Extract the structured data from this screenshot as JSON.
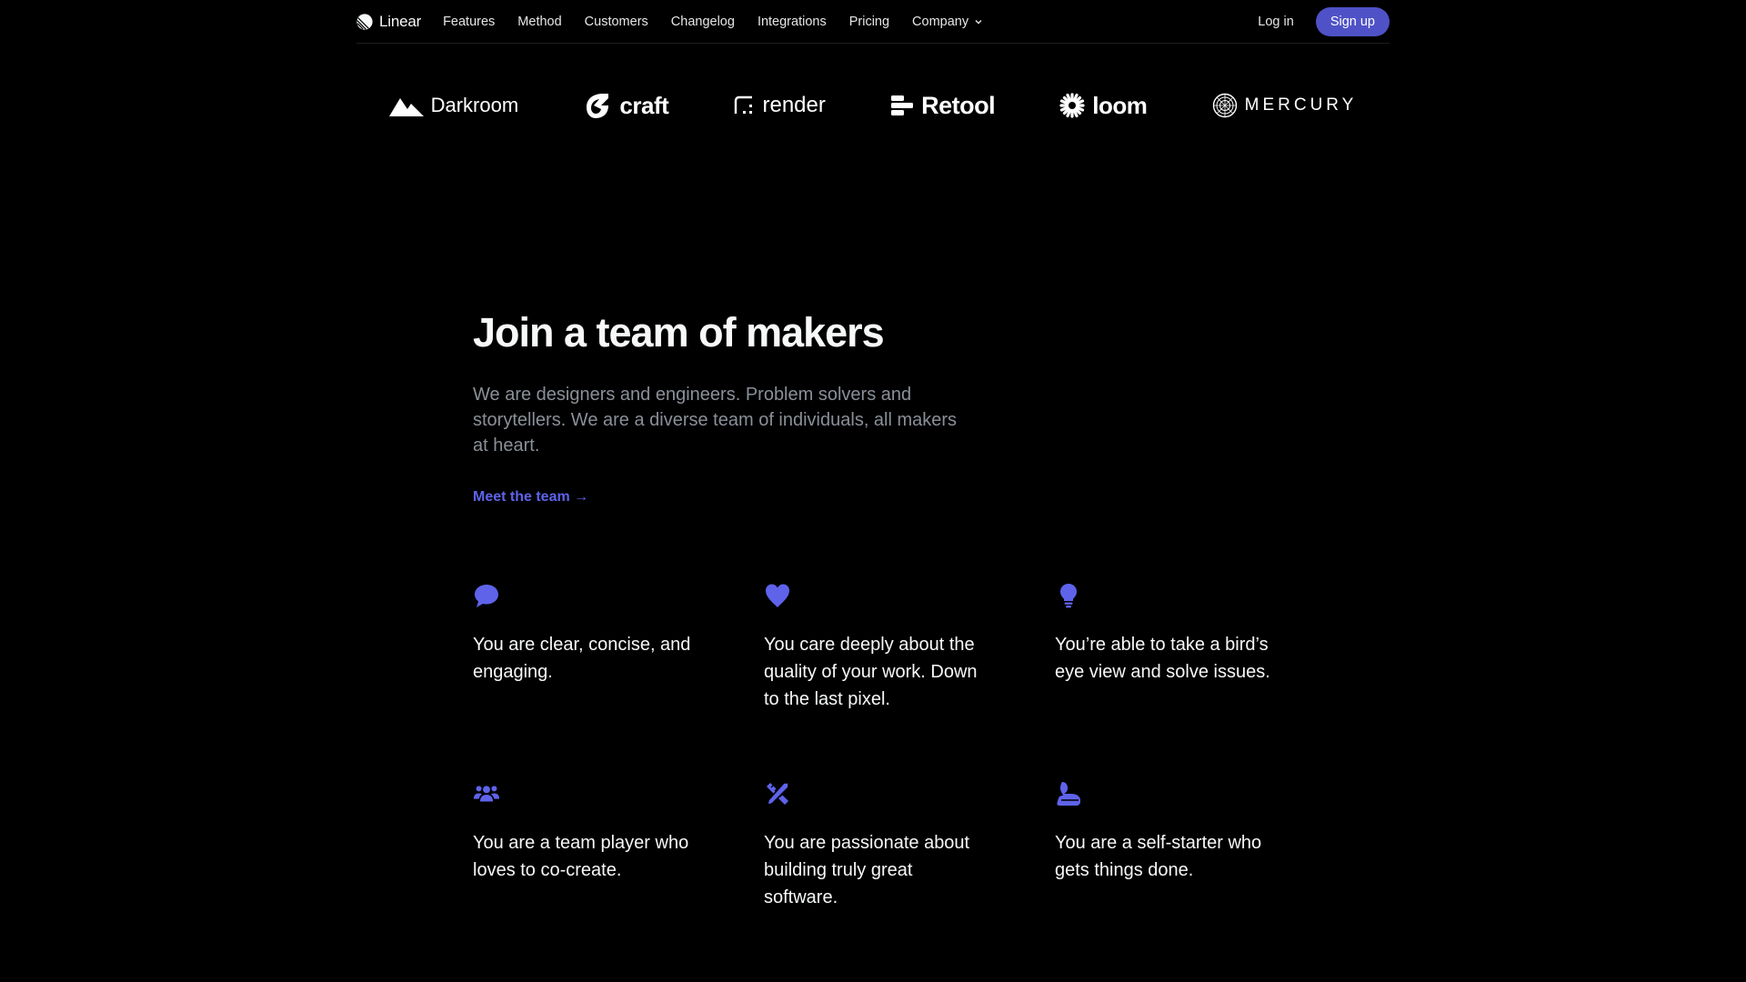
{
  "nav": {
    "brand": "Linear",
    "links": [
      "Features",
      "Method",
      "Customers",
      "Changelog",
      "Integrations",
      "Pricing",
      "Company"
    ],
    "login": "Log in",
    "signup": "Sign up"
  },
  "logos": [
    {
      "name": "Darkroom",
      "icon": "mountain-icon"
    },
    {
      "name": "craft",
      "icon": "craft-icon"
    },
    {
      "name": "render",
      "icon": "render-icon"
    },
    {
      "name": "Retool",
      "icon": "retool-icon"
    },
    {
      "name": "loom",
      "icon": "loom-icon"
    },
    {
      "name": "MERCURY",
      "icon": "mercury-icon"
    }
  ],
  "hero": {
    "title": "Join a team of makers",
    "description": "We are designers and engineers. Problem solvers and storytellers. We are a diverse team of individuals, all makers at heart.",
    "link": "Meet the team →"
  },
  "values": [
    {
      "icon": "chat-bubble-icon",
      "text": "You are clear, concise, and engaging."
    },
    {
      "icon": "heart-icon",
      "text": "You care deeply about the quality of your work. Down to the last pixel."
    },
    {
      "icon": "lightbulb-icon",
      "text": "You’re able to take a bird’s eye view and solve issues."
    },
    {
      "icon": "team-icon",
      "text": "You are a team player who loves to co-create."
    },
    {
      "icon": "pencil-ruler-icon",
      "text": "You are passionate about building truly great software."
    },
    {
      "icon": "self-starter-icon",
      "text": "You are a self-starter who gets things done."
    }
  ],
  "colors": {
    "background": "#000000",
    "accent": "#5e63ea",
    "signup_bg": "#4f52c7",
    "muted_text": "#8a8f98",
    "icon": "#5e63ea"
  }
}
